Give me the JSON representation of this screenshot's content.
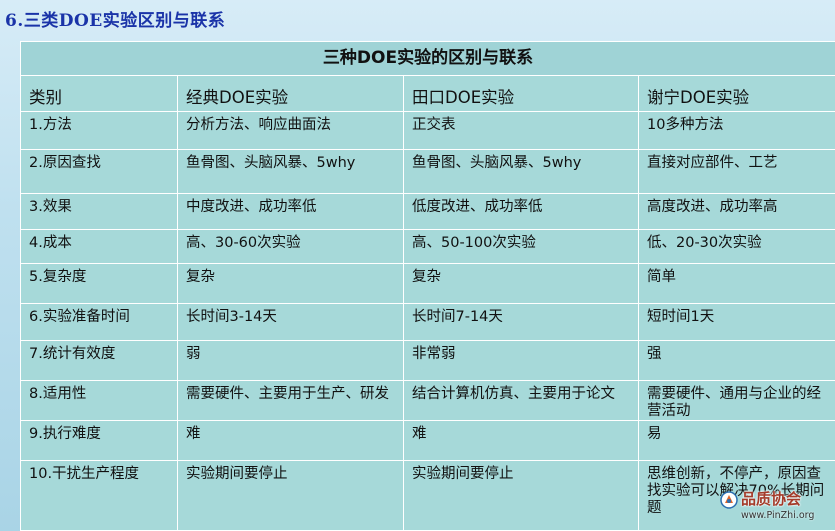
{
  "heading": "6.三类DOE实验区别与联系",
  "table": {
    "title": "三种DOE实验的区别与联系",
    "headers": [
      "类别",
      "经典DOE实验",
      "田口DOE实验",
      "谢宁DOE实验"
    ],
    "rows": [
      [
        "1.方法",
        "分析方法、响应曲面法",
        "正交表",
        "10多种方法"
      ],
      [
        "2.原因查找",
        "鱼骨图、头脑风暴、5why",
        "鱼骨图、头脑风暴、5why",
        "直接对应部件、工艺"
      ],
      [
        "3.效果",
        "中度改进、成功率低",
        "低度改进、成功率低",
        "高度改进、成功率高"
      ],
      [
        "4.成本",
        "高、30-60次实验",
        "高、50-100次实验",
        "低、20-30次实验"
      ],
      [
        "5.复杂度",
        "复杂",
        "复杂",
        "简单"
      ],
      [
        "6.实验准备时间",
        "长时间3-14天",
        "长时间7-14天",
        "短时间1天"
      ],
      [
        "7.统计有效度",
        "弱",
        "非常弱",
        "强"
      ],
      [
        "8.适用性",
        "需要硬件、主要用于生产、研发",
        "结合计算机仿真、主要用于论文",
        "需要硬件、通用与企业的经营活动"
      ],
      [
        "9.执行难度",
        "难",
        "难",
        "易"
      ],
      [
        "10.干扰生产程度",
        "实验期间要停止",
        "实验期间要停止",
        "思维创新，不停产，原因查找实验可以解决70%长期问题"
      ]
    ]
  },
  "watermark": {
    "name": "品质协会",
    "url": "www.PinZhi.org"
  },
  "colors": {
    "heading": "#1a33a8",
    "cell_bg": "#a6d9d9",
    "grid": "#ffffff"
  }
}
